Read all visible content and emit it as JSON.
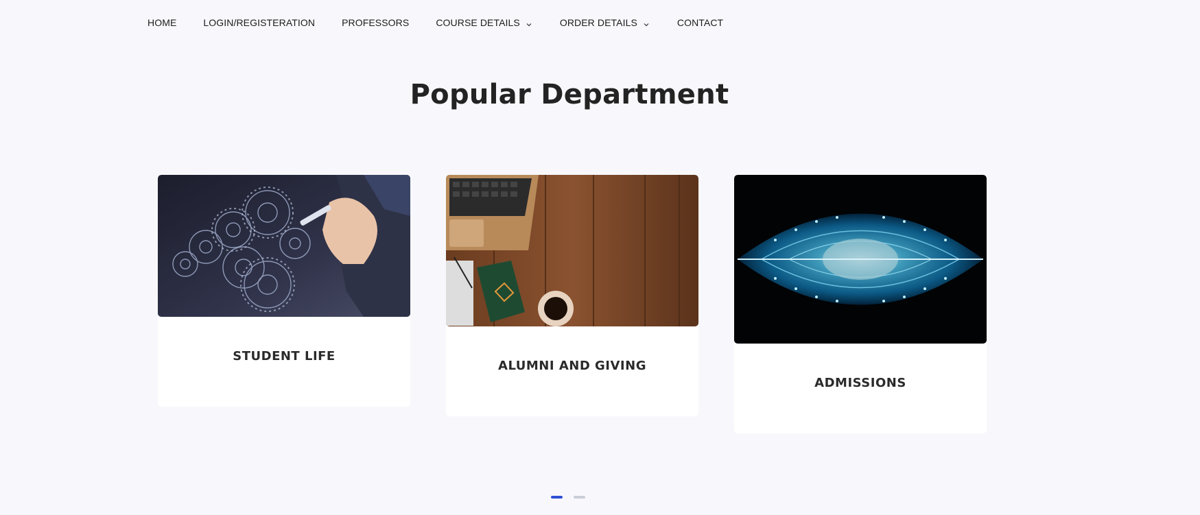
{
  "nav": {
    "items": [
      {
        "label": "HOME",
        "has_dropdown": false
      },
      {
        "label": "LOGIN/REGISTERATION",
        "has_dropdown": false
      },
      {
        "label": "PROFESSORS",
        "has_dropdown": false
      },
      {
        "label": "COURSE DETAILS",
        "has_dropdown": true
      },
      {
        "label": "ORDER DETAILS",
        "has_dropdown": true
      },
      {
        "label": "CONTACT",
        "has_dropdown": false
      }
    ]
  },
  "section": {
    "title": "Popular Department"
  },
  "departments": [
    {
      "label": "STUDENT LIFE",
      "image": "gears-drawing-hand"
    },
    {
      "label": "ALUMNI AND GIVING",
      "image": "laptop-wood-desk"
    },
    {
      "label": "ADMISSIONS",
      "image": "blue-lit-building"
    }
  ],
  "pagination": {
    "count": 2,
    "active": 0
  },
  "colors": {
    "background": "#f8f8fc",
    "accent": "#2f50d6",
    "inactive_dot": "#c9cdd6"
  }
}
